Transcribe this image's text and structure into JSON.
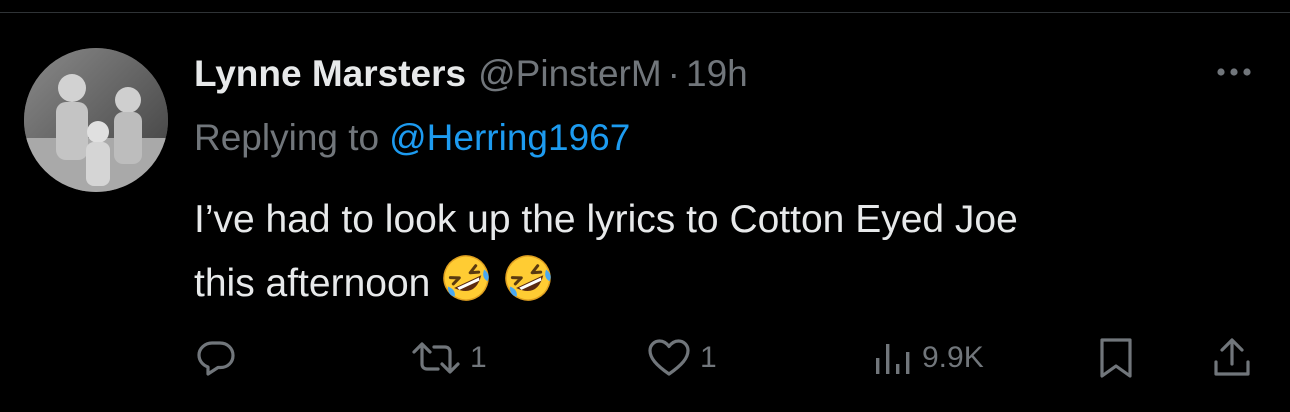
{
  "tweet": {
    "author": {
      "display_name": "Lynne Marsters",
      "handle": "@PinsterM",
      "separator": "·",
      "time": "19h"
    },
    "reply": {
      "prefix": "Replying to",
      "mention": "@Herring1967"
    },
    "text": {
      "line1": "I’ve had to look up the lyrics to Cotton Eyed Joe",
      "line2": "this afternoon"
    },
    "emojis": [
      "rolling-on-floor-laughing-icon",
      "rolling-on-floor-laughing-icon"
    ],
    "actions": {
      "reply": {
        "icon": "reply-icon",
        "count": ""
      },
      "retweet": {
        "icon": "retweet-icon",
        "count": "1"
      },
      "like": {
        "icon": "heart-icon",
        "count": "1"
      },
      "views": {
        "icon": "views-chart-icon",
        "count": "9.9K"
      },
      "bookmark": {
        "icon": "bookmark-icon"
      },
      "share": {
        "icon": "share-icon"
      }
    }
  },
  "colors": {
    "background": "#000000",
    "primary_text": "#e7e9ea",
    "secondary_text": "#71767b",
    "link": "#1d9bf0",
    "divider": "#2f3336"
  }
}
